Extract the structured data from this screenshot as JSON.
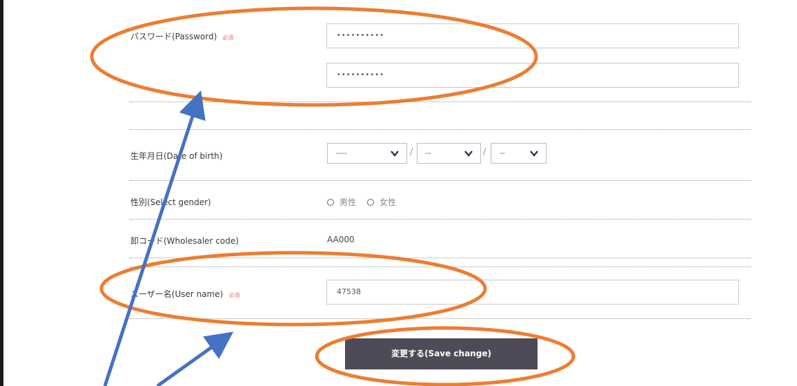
{
  "form": {
    "password": {
      "label": "パスワード(Password)",
      "required": "必須",
      "value1": "••••••••••",
      "value2": "••••••••••"
    },
    "birth": {
      "label": "生年月日(Date of birth)",
      "year": "----",
      "month": "--",
      "day": "--",
      "separator": "/"
    },
    "gender": {
      "label": "性別(Select gender)",
      "option_male": "男性",
      "option_female": "女性"
    },
    "wholesaler": {
      "label": "卸コード(Wholesaler code)",
      "value": "AA000"
    },
    "username": {
      "label": "ユーザー名(User name)",
      "required": "必須",
      "value": "47538"
    },
    "save_label": "変更する(Save change)"
  },
  "annotation_colors": {
    "ellipse": "#ED7D31",
    "arrow": "#4472C4"
  }
}
